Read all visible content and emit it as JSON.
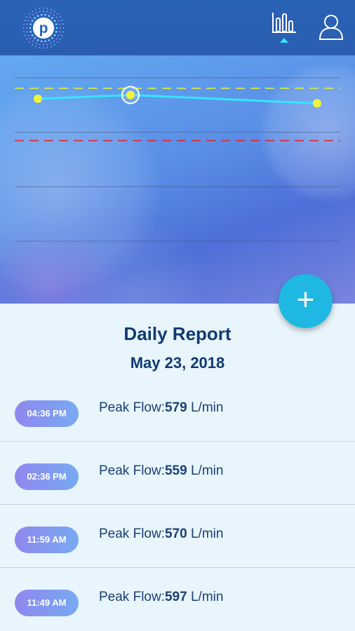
{
  "app": {
    "logo_letter": "p",
    "nav": [
      {
        "icon": "bar-chart-icon",
        "active": true
      },
      {
        "icon": "profile-icon",
        "active": false
      }
    ]
  },
  "chart_data": {
    "type": "line",
    "title": "",
    "xlabel": "",
    "ylabel": "",
    "series": [
      {
        "values": [
          570,
          579,
          559
        ],
        "color": "#35e6ff"
      }
    ],
    "selected_point_index": 1,
    "reference_lines": [
      {
        "value": 595,
        "style": "dashed",
        "color": "#d9f03a"
      },
      {
        "value": 470,
        "style": "dashed",
        "color": "#e0262c"
      }
    ],
    "ylim": [
      220,
      640
    ],
    "grid": true,
    "point_color": "#f1f53a"
  },
  "fab": {
    "icon": "plus-icon",
    "label": "+"
  },
  "report": {
    "title": "Daily Report",
    "date": "May 23, 2018",
    "entries": [
      {
        "time": "04:36 PM",
        "label": "Peak Flow:",
        "value": "579",
        "unit": "L/min"
      },
      {
        "time": "02:36 PM",
        "label": "Peak Flow:",
        "value": "559",
        "unit": "L/min"
      },
      {
        "time": "11:59 AM",
        "label": "Peak Flow:",
        "value": "570",
        "unit": "L/min"
      },
      {
        "time": "11:49 AM",
        "label": "Peak Flow:",
        "value": "597",
        "unit": "L/min"
      }
    ]
  }
}
